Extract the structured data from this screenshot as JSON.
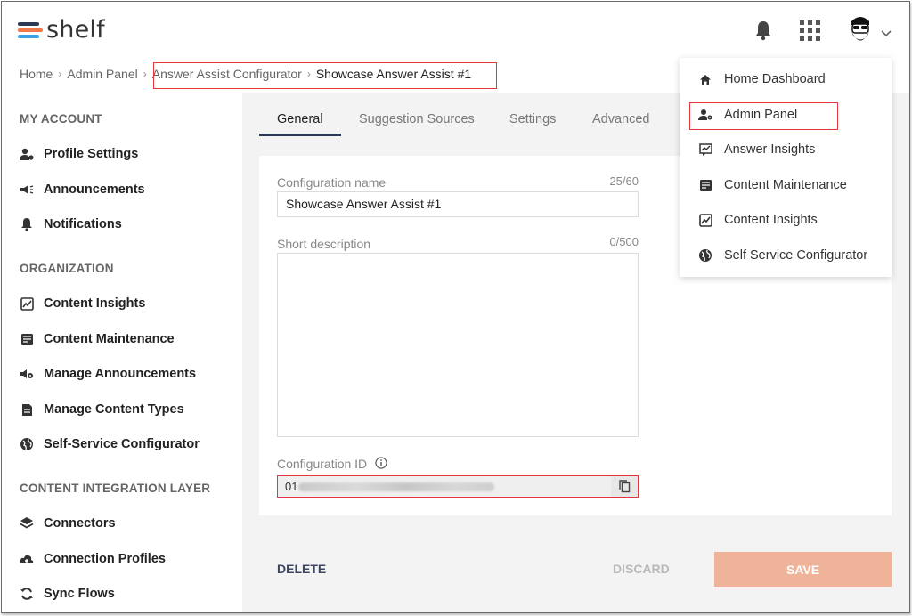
{
  "app": {
    "logo_text": "shelf"
  },
  "colors": {
    "logo_bar_1": "#2a3a55",
    "logo_bar_2": "#f07849",
    "logo_bar_3": "#3aa0e3",
    "accent_save": "#efb39a",
    "highlight": "#e2353d"
  },
  "header": {
    "icons": [
      "bell-icon",
      "apps-grid-icon",
      "avatar",
      "chevron-down-icon"
    ]
  },
  "breadcrumb": {
    "items": [
      "Home",
      "Admin Panel",
      "Answer Assist Configurator"
    ],
    "separator": "›",
    "current": "Showcase Answer Assist #1"
  },
  "sidebar": {
    "sections": [
      {
        "title": "MY ACCOUNT",
        "items": [
          {
            "label": "Profile Settings",
            "icon": "profile-settings-icon"
          },
          {
            "label": "Announcements",
            "icon": "megaphone-icon"
          },
          {
            "label": "Notifications",
            "icon": "bell-icon"
          }
        ]
      },
      {
        "title": "ORGANIZATION",
        "items": [
          {
            "label": "Content Insights",
            "icon": "insights-chart-icon"
          },
          {
            "label": "Content Maintenance",
            "icon": "maintenance-icon"
          },
          {
            "label": "Manage Announcements",
            "icon": "manage-announcements-icon"
          },
          {
            "label": "Manage Content Types",
            "icon": "document-icon"
          },
          {
            "label": "Self-Service Configurator",
            "icon": "globe-icon"
          }
        ]
      },
      {
        "title": "CONTENT INTEGRATION LAYER",
        "items": [
          {
            "label": "Connectors",
            "icon": "layers-icon"
          },
          {
            "label": "Connection Profiles",
            "icon": "cloud-icon"
          },
          {
            "label": "Sync Flows",
            "icon": "sync-icon"
          }
        ]
      }
    ]
  },
  "tabs": [
    {
      "label": "General",
      "active": true
    },
    {
      "label": "Suggestion Sources",
      "active": false
    },
    {
      "label": "Settings",
      "active": false
    },
    {
      "label": "Advanced",
      "active": false
    }
  ],
  "form": {
    "config_name_label": "Configuration name",
    "config_name_count": "25/60",
    "config_name_value": "Showcase Answer Assist #1",
    "short_desc_label": "Short description",
    "short_desc_count": "0/500",
    "short_desc_value": "",
    "config_id_label": "Configuration ID",
    "config_id_prefix": "01"
  },
  "actions": {
    "delete": "DELETE",
    "discard": "DISCARD",
    "save": "SAVE"
  },
  "menu": {
    "items": [
      {
        "label": "Home Dashboard",
        "icon": "home-icon"
      },
      {
        "label": "Admin Panel",
        "icon": "admin-panel-icon"
      },
      {
        "label": "Answer Insights",
        "icon": "answer-insights-icon"
      },
      {
        "label": "Content Maintenance",
        "icon": "maintenance-icon"
      },
      {
        "label": "Content Insights",
        "icon": "insights-chart-icon"
      },
      {
        "label": "Self Service Configurator",
        "icon": "globe-icon"
      }
    ]
  }
}
